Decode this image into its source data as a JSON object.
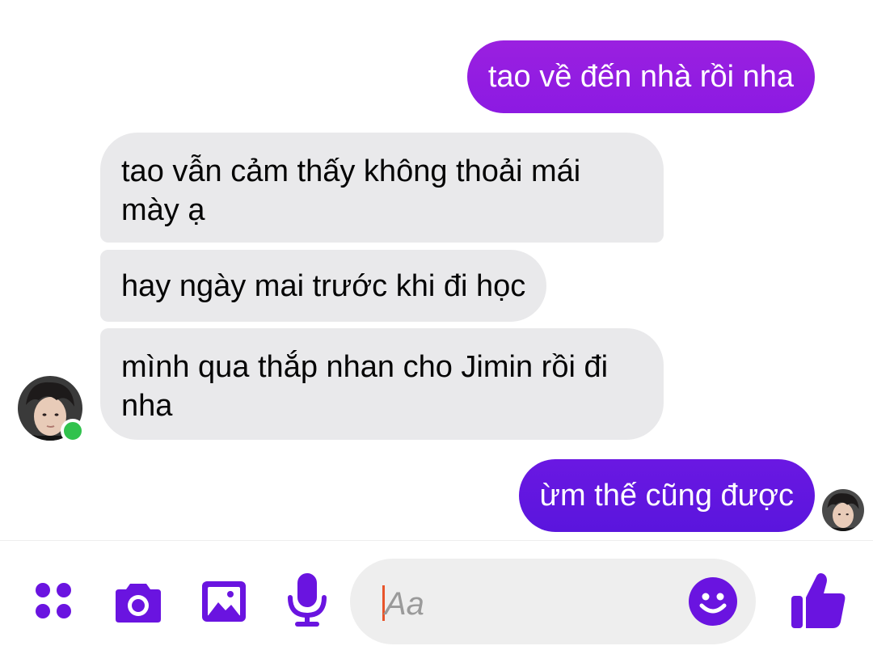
{
  "messages": [
    {
      "direction": "sent",
      "text": "tao về đến nhà rồi nha"
    },
    {
      "direction": "received",
      "text": "tao vẫn cảm thấy không thoải mái mày ạ"
    },
    {
      "direction": "received",
      "text": "hay ngày mai trước khi đi học"
    },
    {
      "direction": "received",
      "text": "mình qua thắp nhan cho Jimin rồi đi nha"
    },
    {
      "direction": "sent",
      "text": "ừm thế cũng được"
    }
  ],
  "contact": {
    "online": true,
    "status_color": "#31c24d"
  },
  "composer": {
    "placeholder": "Aa",
    "buttons": [
      "more-actions-icon",
      "camera-icon",
      "gallery-icon",
      "microphone-icon",
      "emoji-icon",
      "thumbs-up-icon"
    ]
  },
  "colors": {
    "accent": "#6a14e0",
    "sent_bubble_top": "#9a20e0",
    "sent_bubble_bottom": "#5a15dd",
    "received_bubble": "#e9e9eb",
    "input_background": "#eeeeee",
    "caret": "#e8542a"
  }
}
